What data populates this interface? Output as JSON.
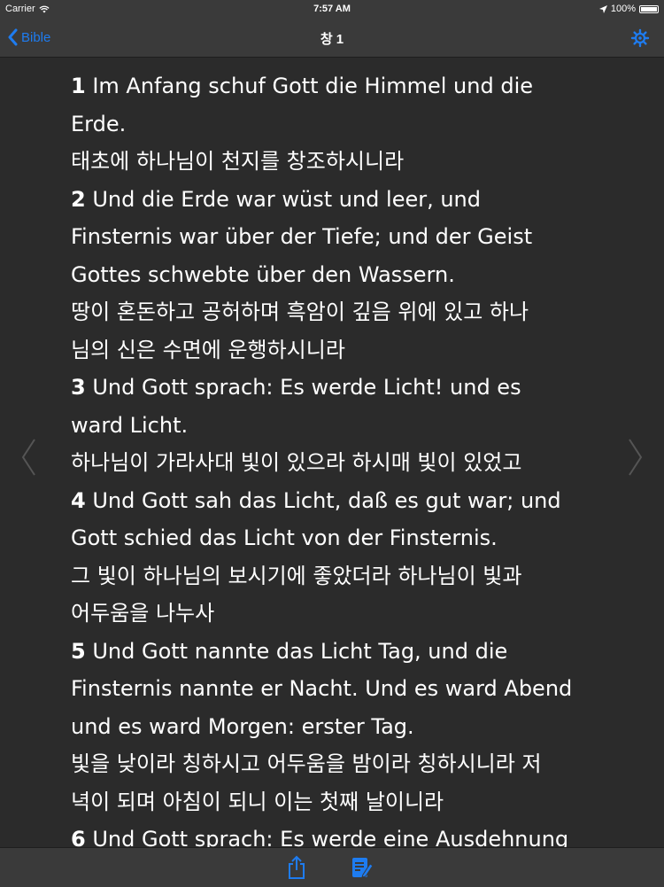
{
  "status_bar": {
    "carrier": "Carrier",
    "time": "7:57 AM",
    "battery": "100%",
    "battery_level": 1.0
  },
  "nav": {
    "back_label": "Bible",
    "title": "창 1",
    "settings_icon": "gear-icon"
  },
  "verses": [
    {
      "number": "1",
      "german_lines": [
        "Im Anfang schuf Gott die Himmel und die",
        "Erde."
      ],
      "korean_lines": [
        "태초에 하나님이 천지를 창조하시니라"
      ]
    },
    {
      "number": "2",
      "german_lines": [
        "Und die Erde war wüst und leer, und",
        "Finsternis war über der Tiefe; und der Geist",
        "Gottes schwebte über den Wassern."
      ],
      "korean_lines": [
        "땅이 혼돈하고 공허하며 흑암이 깊음 위에 있고 하나",
        "님의 신은 수면에 운행하시니라"
      ]
    },
    {
      "number": "3",
      "german_lines": [
        "Und Gott sprach: Es werde Licht! und es",
        "ward Licht."
      ],
      "korean_lines": [
        "하나님이 가라사대 빛이 있으라 하시매 빛이 있었고"
      ]
    },
    {
      "number": "4",
      "german_lines": [
        "Und Gott sah das Licht, daß es gut war; und",
        "Gott schied das Licht von der Finsternis."
      ],
      "korean_lines": [
        "그 빛이 하나님의 보시기에 좋았더라 하나님이 빛과",
        "어두움을 나누사"
      ]
    },
    {
      "number": "5",
      "german_lines": [
        "Und Gott nannte das Licht Tag, und die",
        "Finsternis nannte er Nacht. Und es ward Abend",
        "und es ward Morgen: erster Tag."
      ],
      "korean_lines": [
        "빛을 낮이라 칭하시고 어두움을 밤이라 칭하시니라 저",
        "녁이 되며 아침이 되니 이는 첫째 날이니라"
      ]
    },
    {
      "number": "6",
      "german_lines": [
        "Und Gott sprach: Es werde eine Ausdehnung"
      ],
      "korean_lines": []
    }
  ],
  "icons": {
    "prev": "chevron-left-icon",
    "next": "chevron-right-icon",
    "share": "share-icon",
    "note": "note-edit-icon"
  },
  "colors": {
    "accent": "#1e7cf0",
    "background": "#2b2b2b",
    "bar": "#3a3a3a",
    "text": "#ffffff",
    "arrow": "#555555"
  }
}
